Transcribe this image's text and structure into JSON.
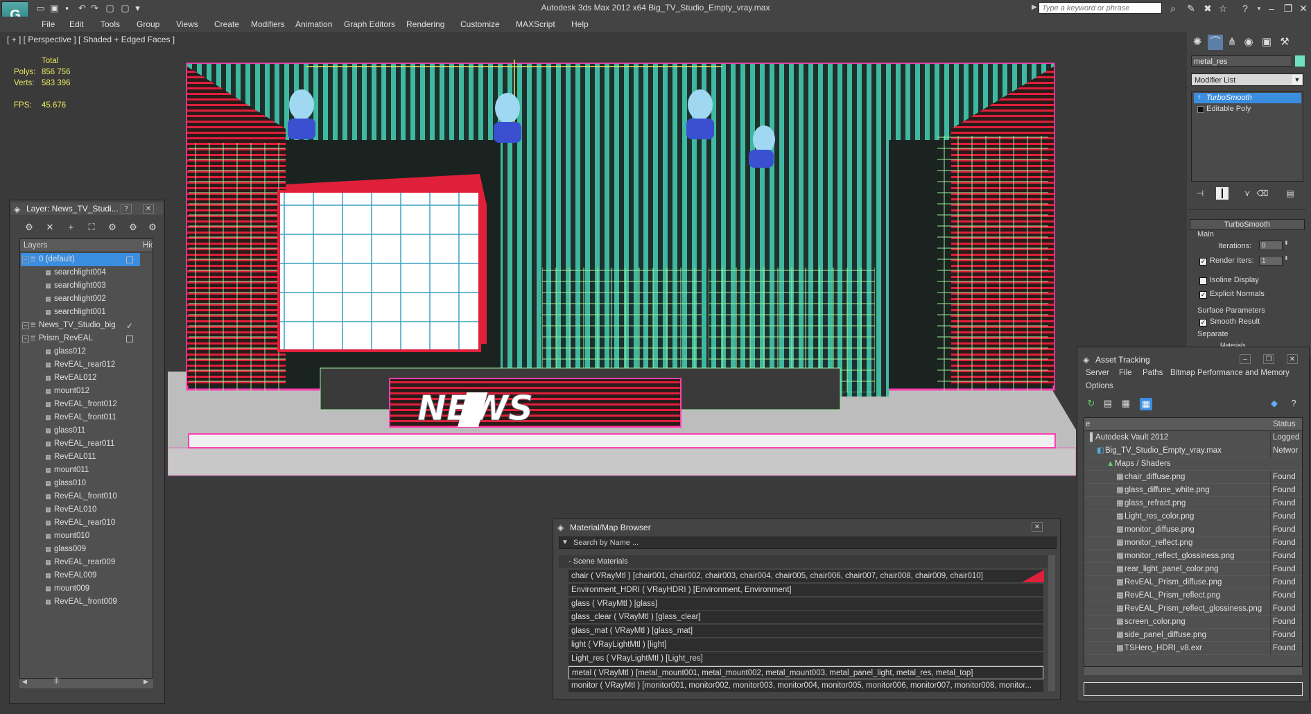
{
  "app": {
    "title": "Autodesk 3ds Max  2012 x64     Big_TV_Studio_Empty_vray.max",
    "search_placeholder": "Type a keyword or phrase",
    "logo_icon": "app-logo-icon",
    "logo_text": "G"
  },
  "menu": [
    "File",
    "Edit",
    "Tools",
    "Group",
    "Views",
    "Create",
    "Modifiers",
    "Animation",
    "Graph Editors",
    "Rendering",
    "Customize",
    "MAXScript",
    "Help"
  ],
  "viewport": {
    "label": "[ + ] [ Perspective ] [ Shaded + Edged Faces ]",
    "stats": {
      "total_label": "Total",
      "polys_label": "Polys:",
      "polys": "856 756",
      "verts_label": "Verts:",
      "verts": "583 396",
      "fps_label": "FPS:",
      "fps": "45.676"
    },
    "scene_text": "NEWS"
  },
  "command_panel": {
    "object_name": "metal_res",
    "object_color": "#6fe0c0",
    "modifier_list": "Modifier List",
    "stack": [
      "TurboSmooth",
      "Editable Poly"
    ],
    "rollout_title": "TurboSmooth",
    "main_label": "Main",
    "iterations_label": "Iterations:",
    "iterations": "0",
    "render_iters_label": "Render Iters:",
    "render_iters": "1",
    "isoline_label": "Isoline Display",
    "explicit_normals_label": "Explicit Normals",
    "surface_params_label": "Surface Parameters",
    "smooth_result_label": "Smooth Result",
    "separate_label": "Separate",
    "materials_label": "Materials"
  },
  "layer_window": {
    "title": "Layer: News_TV_Studi...",
    "help": "?",
    "close": "✕",
    "col_layers": "Layers",
    "col_hide": "Hic",
    "rows": [
      {
        "label": "0 (default)",
        "indent": 0
      },
      {
        "label": "searchlight004",
        "indent": 1
      },
      {
        "label": "searchlight003",
        "indent": 1
      },
      {
        "label": "searchlight002",
        "indent": 1
      },
      {
        "label": "searchlight001",
        "indent": 1
      },
      {
        "label": "News_TV_Studio_big",
        "indent": 0
      },
      {
        "label": "Prism_RevEAL",
        "indent": 0
      },
      {
        "label": "glass012",
        "indent": 1
      },
      {
        "label": "RevEAL_rear012",
        "indent": 1
      },
      {
        "label": "RevEAL012",
        "indent": 1
      },
      {
        "label": "mount012",
        "indent": 1
      },
      {
        "label": "RevEAL_front012",
        "indent": 1
      },
      {
        "label": "RevEAL_front011",
        "indent": 1
      },
      {
        "label": "glass011",
        "indent": 1
      },
      {
        "label": "RevEAL_rear011",
        "indent": 1
      },
      {
        "label": "RevEAL011",
        "indent": 1
      },
      {
        "label": "mount011",
        "indent": 1
      },
      {
        "label": "glass010",
        "indent": 1
      },
      {
        "label": "RevEAL_front010",
        "indent": 1
      },
      {
        "label": "RevEAL010",
        "indent": 1
      },
      {
        "label": "RevEAL_rear010",
        "indent": 1
      },
      {
        "label": "mount010",
        "indent": 1
      },
      {
        "label": "glass009",
        "indent": 1
      },
      {
        "label": "RevEAL_rear009",
        "indent": 1
      },
      {
        "label": "RevEAL009",
        "indent": 1
      },
      {
        "label": "mount009",
        "indent": 1
      },
      {
        "label": "RevEAL_front009",
        "indent": 1
      }
    ]
  },
  "material_browser": {
    "title": "Material/Map Browser",
    "close": "✕",
    "search_placeholder": "Search by Name ...",
    "group": "- Scene Materials",
    "rows": [
      "chair  ( VRayMtl )  [chair001, chair002, chair003, chair004, chair005, chair006, chair007, chair008, chair009, chair010]",
      "Environment_HDRI  ( VRayHDRI )  [Environment, Environment]",
      "glass  ( VRayMtl )  [glass]",
      "glass_clear  ( VRayMtl )  [glass_clear]",
      "glass_mat  ( VRayMtl )  [glass_mat]",
      "light  ( VRayLightMtl )  [light]",
      "Light_res  ( VRayLightMtl )  [Light_res]",
      "metal  ( VRayMtl )  [metal_mount001, metal_mount002, metal_mount003, metal_panel_light, metal_res, metal_top]",
      "monitor  ( VRayMtl )  [monitor001, monitor002, monitor003, monitor004, monitor005, monitor006, monitor007, monitor008, monitor..."
    ]
  },
  "asset_tracking": {
    "title": "Asset Tracking",
    "menu": [
      "Server",
      "File",
      "Paths",
      "Bitmap Performance and Memory",
      "Options"
    ],
    "col_name": "e",
    "col_status": "Status",
    "rows": [
      {
        "name": "Autodesk Vault 2012",
        "status": "Logged",
        "indent": 0
      },
      {
        "name": "Big_TV_Studio_Empty_vray.max",
        "status": "Networ",
        "indent": 1
      },
      {
        "name": "Maps / Shaders",
        "status": "",
        "indent": 2
      },
      {
        "name": "chair_diffuse.png",
        "status": "Found",
        "indent": 3
      },
      {
        "name": "glass_diffuse_white.png",
        "status": "Found",
        "indent": 3
      },
      {
        "name": "glass_refract.png",
        "status": "Found",
        "indent": 3
      },
      {
        "name": "Light_res_color.png",
        "status": "Found",
        "indent": 3
      },
      {
        "name": "monitor_diffuse.png",
        "status": "Found",
        "indent": 3
      },
      {
        "name": "monitor_reflect.png",
        "status": "Found",
        "indent": 3
      },
      {
        "name": "monitor_reflect_glossiness.png",
        "status": "Found",
        "indent": 3
      },
      {
        "name": "rear_light_panel_color.png",
        "status": "Found",
        "indent": 3
      },
      {
        "name": "RevEAL_Prism_diffuse.png",
        "status": "Found",
        "indent": 3
      },
      {
        "name": "RevEAL_Prism_reflect.png",
        "status": "Found",
        "indent": 3
      },
      {
        "name": "RevEAL_Prism_reflect_glossiness.png",
        "status": "Found",
        "indent": 3
      },
      {
        "name": "screen_color.png",
        "status": "Found",
        "indent": 3
      },
      {
        "name": "side_panel_diffuse.png",
        "status": "Found",
        "indent": 3
      },
      {
        "name": "TSHero_HDRI_v8.exr",
        "status": "Found",
        "indent": 3
      }
    ]
  },
  "colors": {
    "selection": "#3b8de0",
    "wire_teal": "#3fb8a0",
    "wire_magenta": "#ff3fb0",
    "wire_red": "#e0203a",
    "wire_green": "#9cf09c",
    "stats_yellow": "#e8e860"
  }
}
